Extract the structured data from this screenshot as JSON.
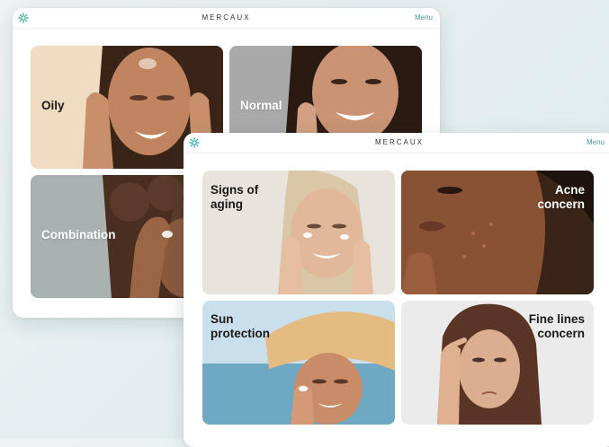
{
  "back_window": {
    "brand": "MERCAUX",
    "menu": "Menu",
    "cards": [
      {
        "label": "Oily"
      },
      {
        "label": "Normal"
      },
      {
        "label": "Combination"
      }
    ]
  },
  "front_window": {
    "brand": "MERCAUX",
    "menu": "Menu",
    "cards": [
      {
        "label_line1": "Signs of",
        "label_line2": "aging"
      },
      {
        "label_line1": "Acne",
        "label_line2": "concern"
      },
      {
        "label_line1": "Sun",
        "label_line2": "protection"
      },
      {
        "label_line1": "Fine lines",
        "label_line2": "concern"
      }
    ]
  },
  "colors": {
    "accent": "#2aa6a0",
    "text_dark": "#1a1a1a"
  },
  "icons": {
    "logo": "flower-logo-icon"
  }
}
